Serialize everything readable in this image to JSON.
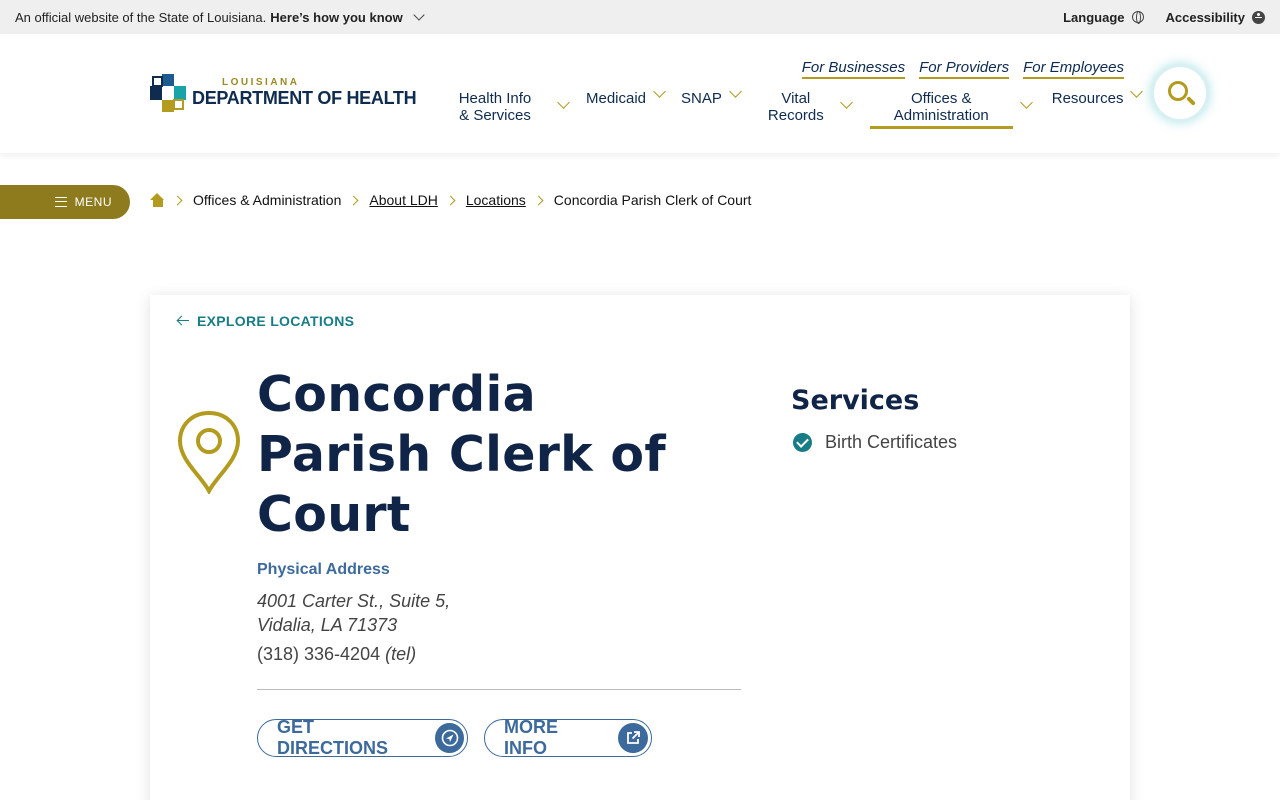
{
  "topbar": {
    "official_text": "An official website of the State of Louisiana.",
    "how_you_know": "Here’s how you know",
    "language": "Language",
    "accessibility": "Accessibility"
  },
  "logo": {
    "state": "LOUISIANA",
    "department": "DEPARTMENT OF HEALTH"
  },
  "util_links": [
    "For Businesses",
    "For Providers",
    "For Employees"
  ],
  "nav": {
    "health_info_1": "Health Info",
    "health_info_2": "& Services",
    "medicaid": "Medicaid",
    "snap": "SNAP",
    "vital_1": "Vital",
    "vital_2": "Records",
    "offices_1": "Offices &",
    "offices_2": "Administration",
    "resources": "Resources"
  },
  "menu_label": "MENU",
  "breadcrumb": [
    "Offices & Administration",
    "About LDH",
    "Locations",
    "Concordia Parish Clerk of Court"
  ],
  "card": {
    "back_link": "EXPLORE LOCATIONS",
    "title_lines": [
      "Concordia",
      "Parish Clerk of",
      "Court"
    ],
    "address_label": "Physical Address",
    "address_line1": "4001 Carter St., Suite 5,",
    "address_line2": "Vidalia, LA 71373",
    "phone": "(318) 336-4204",
    "phone_suffix": "(tel)",
    "directions_btn": "GET DIRECTIONS",
    "more_info_btn": "MORE INFO",
    "services_heading": "Services",
    "services": [
      "Birth Certificates"
    ]
  },
  "colors": {
    "navy": "#0f2447",
    "gold": "#b29b1e",
    "menu_gold": "#8e7b1e",
    "teal": "#177c86",
    "link_blue": "#3d6a9c"
  }
}
